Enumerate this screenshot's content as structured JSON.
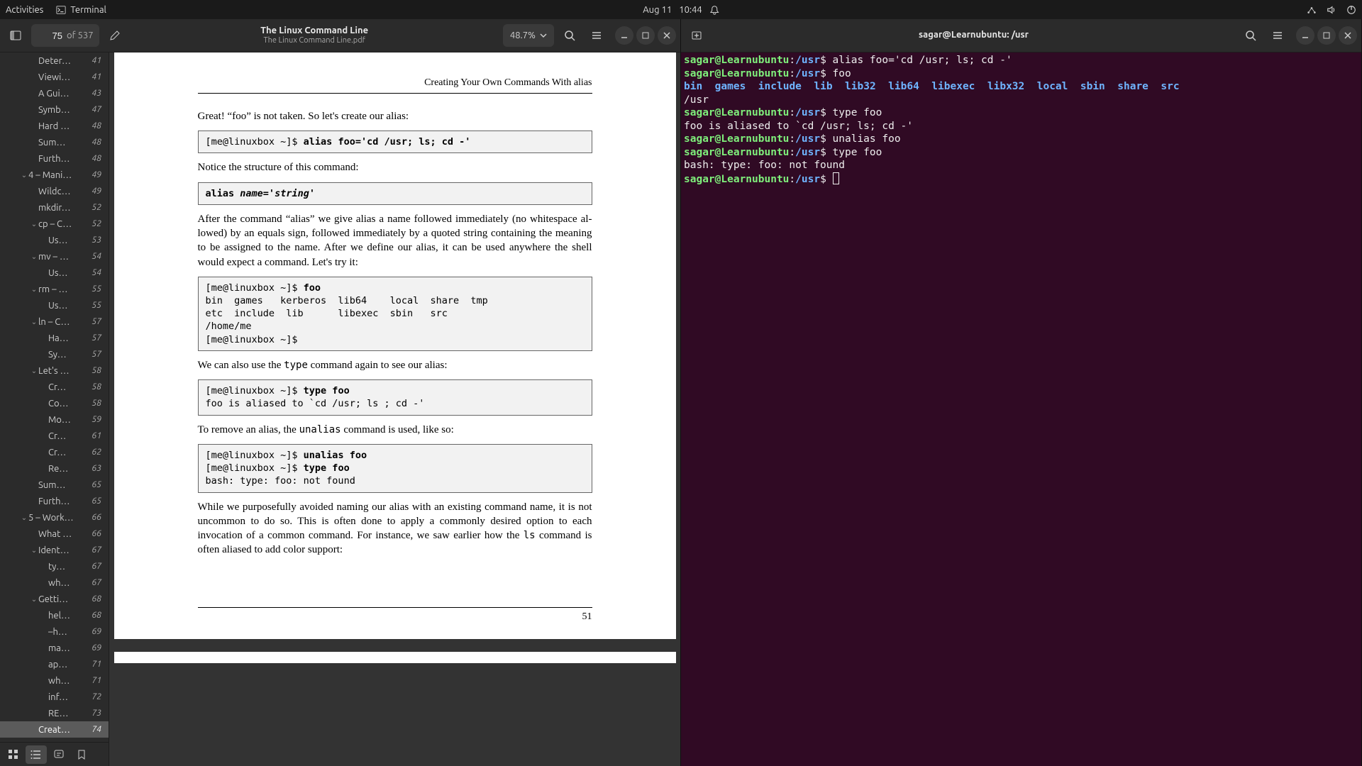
{
  "topbar": {
    "activities": "Activities",
    "appname": "Terminal",
    "date": "Aug 11",
    "time": "10:44"
  },
  "pdf": {
    "doc_title": "The Linux Command Line",
    "doc_subtitle": "The Linux Command Line.pdf",
    "page_current": "75",
    "page_total": "of 537",
    "zoom": "48.7%",
    "outline": [
      {
        "label": "Deter…",
        "page": "41",
        "indent": 3
      },
      {
        "label": "Viewi…",
        "page": "41",
        "indent": 3
      },
      {
        "label": "A Gui…",
        "page": "43",
        "indent": 3
      },
      {
        "label": "Symb…",
        "page": "47",
        "indent": 3
      },
      {
        "label": "Hard …",
        "page": "48",
        "indent": 3
      },
      {
        "label": "Sum…",
        "page": "48",
        "indent": 3
      },
      {
        "label": "Furth…",
        "page": "48",
        "indent": 3
      },
      {
        "label": "4 – Mani…",
        "page": "49",
        "indent": 2,
        "exp": true
      },
      {
        "label": "Wildc…",
        "page": "49",
        "indent": 3
      },
      {
        "label": "mkdir…",
        "page": "52",
        "indent": 3
      },
      {
        "label": "cp – C…",
        "page": "52",
        "indent": 3,
        "exp": true
      },
      {
        "label": "Us…",
        "page": "53",
        "indent": 4
      },
      {
        "label": "mv – …",
        "page": "54",
        "indent": 3,
        "exp": true
      },
      {
        "label": "Us…",
        "page": "54",
        "indent": 4
      },
      {
        "label": "rm – …",
        "page": "55",
        "indent": 3,
        "exp": true
      },
      {
        "label": "Us…",
        "page": "55",
        "indent": 4
      },
      {
        "label": "ln – C…",
        "page": "57",
        "indent": 3,
        "exp": true
      },
      {
        "label": "Ha…",
        "page": "57",
        "indent": 4
      },
      {
        "label": "Sy…",
        "page": "57",
        "indent": 4
      },
      {
        "label": "Let's …",
        "page": "58",
        "indent": 3,
        "exp": true
      },
      {
        "label": "Cr…",
        "page": "58",
        "indent": 4
      },
      {
        "label": "Co…",
        "page": "58",
        "indent": 4
      },
      {
        "label": "Mo…",
        "page": "59",
        "indent": 4
      },
      {
        "label": "Cr…",
        "page": "61",
        "indent": 4
      },
      {
        "label": "Cr…",
        "page": "62",
        "indent": 4
      },
      {
        "label": "Re…",
        "page": "63",
        "indent": 4
      },
      {
        "label": "Sum…",
        "page": "65",
        "indent": 3
      },
      {
        "label": "Furth…",
        "page": "65",
        "indent": 3
      },
      {
        "label": "5 – Work…",
        "page": "66",
        "indent": 2,
        "exp": true
      },
      {
        "label": "What …",
        "page": "66",
        "indent": 3
      },
      {
        "label": "Ident…",
        "page": "67",
        "indent": 3,
        "exp": true
      },
      {
        "label": "ty…",
        "page": "67",
        "indent": 4
      },
      {
        "label": "wh…",
        "page": "67",
        "indent": 4
      },
      {
        "label": "Getti…",
        "page": "68",
        "indent": 3,
        "exp": true
      },
      {
        "label": "hel…",
        "page": "68",
        "indent": 4
      },
      {
        "label": "–h…",
        "page": "69",
        "indent": 4
      },
      {
        "label": "ma…",
        "page": "69",
        "indent": 4
      },
      {
        "label": "ap…",
        "page": "71",
        "indent": 4
      },
      {
        "label": "wh…",
        "page": "71",
        "indent": 4
      },
      {
        "label": "inf…",
        "page": "72",
        "indent": 4
      },
      {
        "label": "RE…",
        "page": "73",
        "indent": 4
      },
      {
        "label": "Creat…",
        "page": "74",
        "indent": 3,
        "sel": true
      }
    ],
    "page": {
      "running_head": "Creating Your Own Commands With alias",
      "p1": "Great! “foo” is not taken. So let's create our alias:",
      "code1_prompt": "[me@linuxbox ~]$ ",
      "code1_bold": "alias foo='cd /usr; ls; cd -'",
      "p2": "Notice the structure of this command:",
      "code2_a": "alias ",
      "code2_b": "name",
      "code2_c": "='",
      "code2_d": "string",
      "code2_e": "'",
      "p3": "After the command “alias” we give alias a name followed immediately (no whitespace al­lowed) by an equals sign, followed immediately by a quoted string containing the mean­ing to be assigned to the name. After we define our alias, it can be used anywhere the shell would expect a command. Let's try it:",
      "code3_l1_prompt": "[me@linuxbox ~]$ ",
      "code3_l1_bold": "foo",
      "code3_l2": "bin  games   kerberos  lib64    local  share  tmp",
      "code3_l3": "etc  include  lib      libexec  sbin   src",
      "code3_l4": "/home/me",
      "code3_l5": "[me@linuxbox ~]$",
      "p4a": "We can also use the ",
      "p4b": "type",
      "p4c": " command again to see our alias:",
      "code4_l1_prompt": "[me@linuxbox ~]$ ",
      "code4_l1_bold": "type foo",
      "code4_l2": "foo is aliased to `cd /usr; ls ; cd -'",
      "p5a": "To remove an alias, the ",
      "p5b": "unalias",
      "p5c": " command is used, like so:",
      "code5_l1_prompt": "[me@linuxbox ~]$ ",
      "code5_l1_bold": "unalias foo",
      "code5_l2_prompt": "[me@linuxbox ~]$ ",
      "code5_l2_bold": "type foo",
      "code5_l3": "bash: type: foo: not found",
      "p6a": "While we purposefully avoided naming our alias with an existing command name, it is not uncommon to do so. This is often done to apply a commonly desired option to each invocation of a common command. For instance, we saw earlier how the ",
      "p6b": "ls",
      "p6c": " command is often aliased to add color support:",
      "pagenum": "51"
    }
  },
  "term": {
    "title": "sagar@Learnubuntu: /usr",
    "host": "sagar@Learnubuntu",
    "path": "/usr",
    "cmd1": "alias foo='cd /usr; ls; cd -'",
    "cmd2": "foo",
    "ls_items": [
      "bin",
      "games",
      "include",
      "lib",
      "lib32",
      "lib64",
      "libexec",
      "libx32",
      "local",
      "sbin",
      "share",
      "src"
    ],
    "pwdline": "/usr",
    "cmd3": "type foo",
    "out3": "foo is aliased to `cd /usr; ls; cd -'",
    "cmd4": "unalias foo",
    "cmd5": "type foo",
    "out5": "bash: type: foo: not found"
  }
}
